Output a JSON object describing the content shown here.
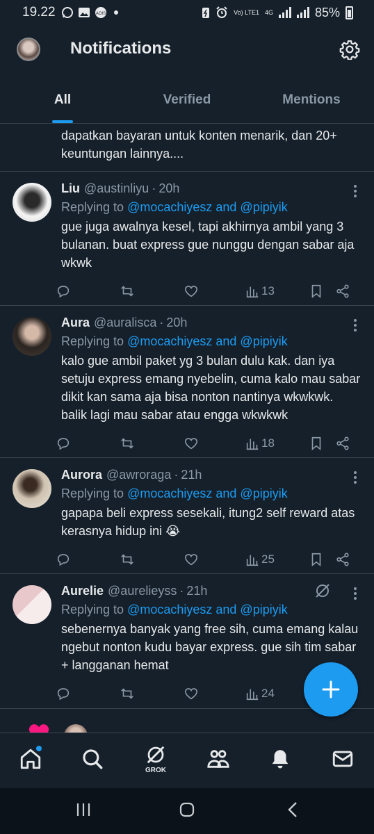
{
  "status_bar": {
    "time": "19.22",
    "network_top": "Vo) LTE1",
    "network_mid": "4G",
    "battery": "85%"
  },
  "header": {
    "title": "Notifications",
    "settings_icon": "gear-icon"
  },
  "tabs": [
    {
      "label": "All",
      "active": true
    },
    {
      "label": "Verified",
      "active": false
    },
    {
      "label": "Mentions",
      "active": false
    }
  ],
  "partial_text": "dapatkan bayaran untuk konten menarik, dan 20+ keuntungan lainnya....",
  "tweets": [
    {
      "name": "Liu",
      "handle": "@austinliyu",
      "time": "20h",
      "reply_prefix": "Replying to",
      "reply_mentions": "@mocachiyesz and @pipiyik",
      "text": "gue juga awalnya kesel, tapi akhirnya ambil yang 3 bulanan. buat express gue nunggu dengan sabar aja wkwk",
      "views": "13"
    },
    {
      "name": "Aura",
      "handle": "@auralisca",
      "time": "20h",
      "reply_prefix": "Replying to",
      "reply_mentions": "@mocachiyesz and @pipiyik",
      "text": "kalo gue ambil paket yg 3 bulan dulu kak. dan iya setuju express emang nyebelin, cuma kalo mau sabar dikit kan sama aja bisa nonton nantinya wkwkwk. balik lagi mau sabar atau engga wkwkwk",
      "views": "18"
    },
    {
      "name": "Aurora",
      "handle": "@awroraga",
      "time": "21h",
      "reply_prefix": "Replying to",
      "reply_mentions": "@mocachiyesz and @pipiyik",
      "text": "gapapa beli express sesekali, itung2 self reward atas kerasnya hidup ini 😭",
      "views": "25"
    },
    {
      "name": "Aurelie",
      "handle": "@aurelieyss",
      "time": "21h",
      "reply_prefix": "Replying to",
      "reply_mentions": "@mocachiyesz and @pipiyik",
      "text": "sebenernya banyak yang free sih, cuma emang kalau ngebut nonton kudu bayar express. gue sih tim sabar + langganan hemat",
      "views": "24"
    }
  ],
  "bottom_nav": {
    "grok_label": "GROK"
  },
  "colors": {
    "background": "#15202b",
    "accent": "#1d9bf0",
    "muted": "#8b98a5",
    "divider": "#38444d"
  }
}
